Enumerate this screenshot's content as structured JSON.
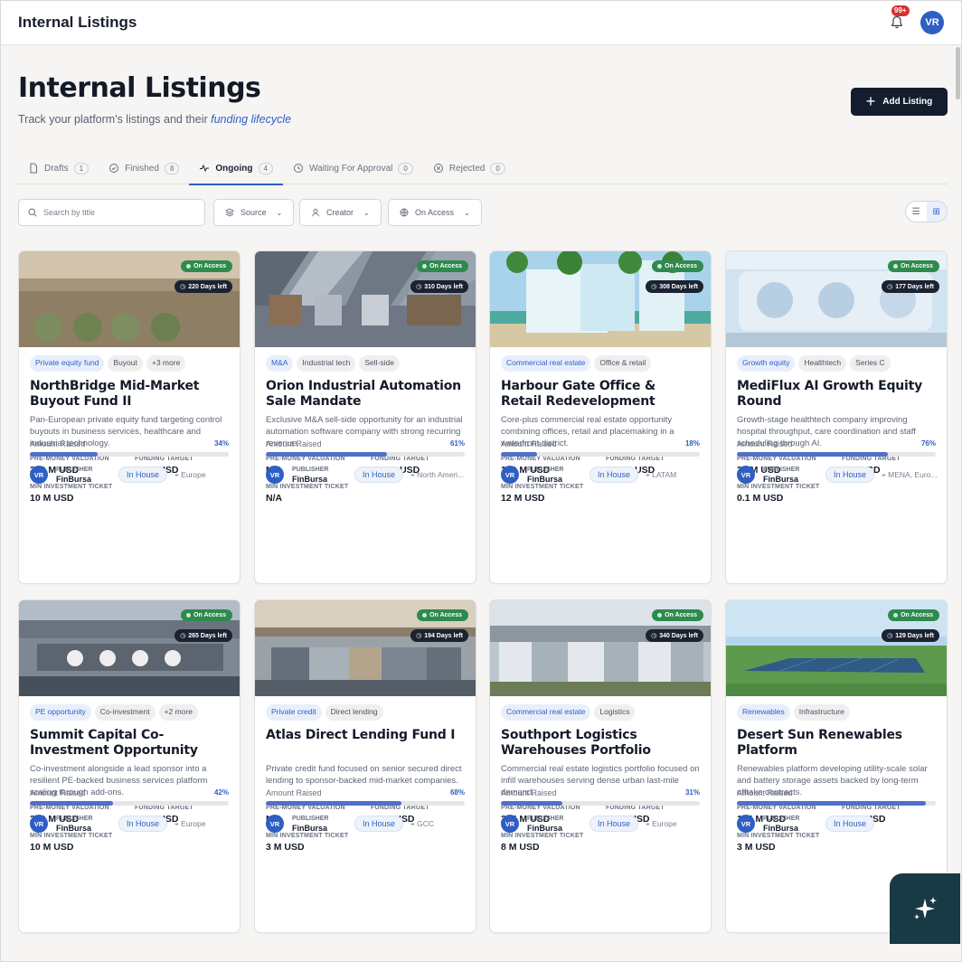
{
  "app": {
    "title": "Internal Listings",
    "notification_count": "99+",
    "user_initials": "VR"
  },
  "header": {
    "title": "Internal Listings",
    "subtitle_prefix": "Track your platform's listings and their ",
    "subtitle_emphasis": "funding lifecycle",
    "add_button": "Add Listing"
  },
  "tabs": [
    {
      "label": "Drafts",
      "count": "1",
      "icon": "document-icon"
    },
    {
      "label": "Finished",
      "count": "8",
      "icon": "check-circle-icon"
    },
    {
      "label": "Ongoing",
      "count": "4",
      "icon": "activity-icon",
      "active": true
    },
    {
      "label": "Waiting For Approval",
      "count": "0",
      "icon": "clock-icon"
    },
    {
      "label": "Rejected",
      "count": "0",
      "icon": "x-circle-icon"
    }
  ],
  "filters": {
    "search_placeholder": "Search by title",
    "source": "Source",
    "creator": "Creator",
    "access": "On Access"
  },
  "labels": {
    "pre_money": "PRE-MONEY VALUATION",
    "funding_target": "FUNDING TARGET",
    "min_ticket": "MIN INVESTMENT TICKET",
    "amount_raised": "Amount Raised",
    "publisher": "PUBLISHER"
  },
  "colors": {
    "accent": "#2f5fc4",
    "on_access": "#2e8a4d",
    "dark": "#141d2e"
  },
  "cards": [
    {
      "access": "On Access",
      "days": "220 Days left",
      "tags": [
        "Private equity fund",
        "Buyout",
        "+3 more"
      ],
      "title": "NorthBridge Mid-Market Buyout Fund II",
      "desc": "Pan-European private equity fund targeting control buyouts in business services, healthcare and industrial technology.",
      "pre_money": "300 M USD",
      "target": "75 M USD",
      "min_ticket": "10 M USD",
      "raised_pct": "34%",
      "raised": 34,
      "publisher_initials": "VR",
      "publisher": "FinBursa",
      "source": "In House",
      "region": "Europe"
    },
    {
      "access": "On Access",
      "days": "310 Days left",
      "tags": [
        "M&A",
        "Industrial tech",
        "Sell-side"
      ],
      "title": "Orion Industrial Automation Sale Mandate",
      "desc": "Exclusive M&A sell-side opportunity for an industrial automation software company with strong recurring revenue.",
      "pre_money": "N/A",
      "target": "297 M USD",
      "min_ticket": "N/A",
      "raised_pct": "61%",
      "raised": 61,
      "publisher_initials": "VR",
      "publisher": "FinBursa",
      "source": "In House",
      "region": "North Ameri..."
    },
    {
      "access": "On Access",
      "days": "308 Days left",
      "tags": [
        "Commercial real estate",
        "Office & retail"
      ],
      "title": "Harbour Gate Office & Retail Redevelopment",
      "desc": "Core-plus commercial real estate opportunity combining offices, retail and placemaking in a waterfront district.",
      "pre_money": "180 M USD",
      "target": "180 M USD",
      "min_ticket": "12 M USD",
      "raised_pct": "18%",
      "raised": 18,
      "publisher_initials": "VR",
      "publisher": "FinBursa",
      "source": "In House",
      "region": "LATAM"
    },
    {
      "access": "On Access",
      "days": "177 Days left",
      "tags": [
        "Growth equity",
        "Healthtech",
        "Series C"
      ],
      "title": "MediFlux AI Growth Equity Round",
      "desc": "Growth-stage healthtech company improving hospital throughput, care coordination and staff scheduling through AI.",
      "pre_money": "25 M USD",
      "target": "5 M USD",
      "min_ticket": "0.1 M USD",
      "raised_pct": "76%",
      "raised": 76,
      "publisher_initials": "VR",
      "publisher": "FinBursa",
      "source": "In House",
      "region": "MENA, Euro..."
    },
    {
      "access": "On Access",
      "days": "265 Days left",
      "tags": [
        "PE opportunity",
        "Co-investment",
        "+2 more"
      ],
      "title": "Summit Capital Co-Investment Opportunity",
      "desc": "Co-investment alongside a lead sponsor into a resilient PE-backed business services platform scaling through add-ons.",
      "pre_money": "350 M USD",
      "target": "90 M USD",
      "min_ticket": "10 M USD",
      "raised_pct": "42%",
      "raised": 42,
      "publisher_initials": "VR",
      "publisher": "FinBursa",
      "source": "In House",
      "region": "Europe"
    },
    {
      "access": "On Access",
      "days": "194 Days left",
      "tags": [
        "Private credit",
        "Direct lending"
      ],
      "title": "Atlas Direct Lending Fund I",
      "desc": "Private credit fund focused on senior secured direct lending to sponsor-backed mid-market companies.",
      "pre_money": "N/A",
      "target": "85 M USD",
      "min_ticket": "3 M USD",
      "raised_pct": "68%",
      "raised": 68,
      "publisher_initials": "VR",
      "publisher": "FinBursa",
      "source": "In House",
      "region": "GCC"
    },
    {
      "access": "On Access",
      "days": "340 Days left",
      "tags": [
        "Commercial real estate",
        "Logistics"
      ],
      "title": "Southport Logistics Warehouses Portfolio",
      "desc": "Commercial real estate logistics portfolio focused on infill warehouses serving dense urban last-mile demand.",
      "pre_money": "225 M USD",
      "target": "95 M USD",
      "min_ticket": "8 M USD",
      "raised_pct": "31%",
      "raised": 31,
      "publisher_initials": "VR",
      "publisher": "FinBursa",
      "source": "In House",
      "region": "Europe"
    },
    {
      "access": "On Access",
      "days": "129 Days left",
      "tags": [
        "Renewables",
        "Infrastructure"
      ],
      "title": "Desert Sun Renewables Platform",
      "desc": "Renewables platform developing utility-scale solar and battery storage assets backed by long-term offtake contracts.",
      "pre_money": "175 M USD",
      "target": "70 M USD",
      "min_ticket": "3 M USD",
      "raised_pct": "",
      "raised": 95,
      "publisher_initials": "VR",
      "publisher": "FinBursa",
      "source": "In House",
      "region": ""
    }
  ]
}
